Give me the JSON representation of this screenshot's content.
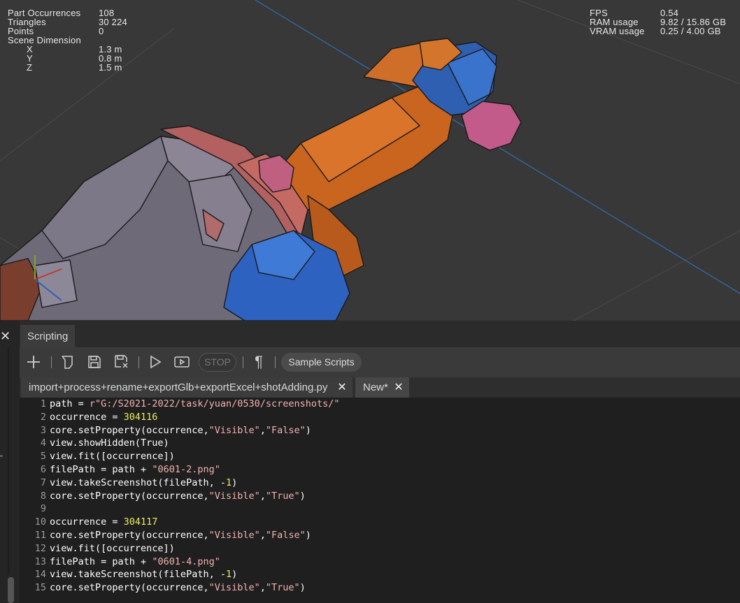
{
  "viewport": {
    "stats_left": [
      {
        "label": "Part Occurrences",
        "value": "108"
      },
      {
        "label": "Triangles",
        "value": "30 224"
      },
      {
        "label": "Points",
        "value": "0"
      },
      {
        "label": "Scene Dimension",
        "value": ""
      },
      {
        "label": "X",
        "value": "1.3 m"
      },
      {
        "label": "Y",
        "value": "0.8 m"
      },
      {
        "label": "Z",
        "value": "1.5 m"
      }
    ],
    "stats_right": [
      {
        "label": "FPS",
        "value": "0.54"
      },
      {
        "label": "RAM usage",
        "value": "9.82 / 15.86 GB"
      },
      {
        "label": "VRAM usage",
        "value": "0.25 / 4.00 GB"
      }
    ],
    "colors": {
      "background": "#383838",
      "axis_line": "#2f6fb5"
    }
  },
  "panel": {
    "close_glyph": "✕",
    "tab_label": "Scripting",
    "left_strip_mark": "\""
  },
  "toolbar": {
    "icons": [
      "add-icon",
      "open-file-icon",
      "save-icon",
      "save-as-icon",
      "play-icon",
      "run-screen-icon",
      "stop-button",
      "paragraph-icon",
      "sample-scripts-button"
    ],
    "stop_label": "STOP",
    "paragraph_glyph": "¶",
    "sample_scripts_label": "Sample Scripts"
  },
  "file_tabs": [
    {
      "label": "import+process+rename+exportGlb+exportExcel+shotAdding.py",
      "close": "✕"
    },
    {
      "label": "New*",
      "close": "✕"
    }
  ],
  "editor": {
    "lines": [
      {
        "n": "1",
        "tokens": [
          [
            "t",
            "path = "
          ],
          [
            "s",
            "r\"G:/S2021-2022/task/yuan/0530/screenshots/\""
          ]
        ]
      },
      {
        "n": "2",
        "tokens": [
          [
            "t",
            "occurrence = "
          ],
          [
            "n",
            "304116"
          ]
        ]
      },
      {
        "n": "3",
        "tokens": [
          [
            "t",
            "core.setProperty(occurrence,"
          ],
          [
            "s",
            "\"Visible\""
          ],
          [
            "t",
            ","
          ],
          [
            "s",
            "\"False\""
          ],
          [
            "t",
            ")"
          ]
        ]
      },
      {
        "n": "4",
        "tokens": [
          [
            "t",
            "view.showHidden(True)"
          ]
        ]
      },
      {
        "n": "5",
        "tokens": [
          [
            "t",
            "view.fit([occurrence])"
          ]
        ]
      },
      {
        "n": "6",
        "tokens": [
          [
            "t",
            "filePath = path + "
          ],
          [
            "s",
            "\"0601-2.png\""
          ]
        ]
      },
      {
        "n": "7",
        "tokens": [
          [
            "t",
            "view.takeScreenshot(filePath, -"
          ],
          [
            "n",
            "1"
          ],
          [
            "t",
            ")"
          ]
        ]
      },
      {
        "n": "8",
        "tokens": [
          [
            "t",
            "core.setProperty(occurrence,"
          ],
          [
            "s",
            "\"Visible\""
          ],
          [
            "t",
            ","
          ],
          [
            "s",
            "\"True\""
          ],
          [
            "t",
            ")"
          ]
        ]
      },
      {
        "n": "9",
        "tokens": []
      },
      {
        "n": "10",
        "tokens": [
          [
            "t",
            "occurrence = "
          ],
          [
            "n",
            "304117"
          ]
        ]
      },
      {
        "n": "11",
        "tokens": [
          [
            "t",
            "core.setProperty(occurrence,"
          ],
          [
            "s",
            "\"Visible\""
          ],
          [
            "t",
            ","
          ],
          [
            "s",
            "\"False\""
          ],
          [
            "t",
            ")"
          ]
        ]
      },
      {
        "n": "12",
        "tokens": [
          [
            "t",
            "view.fit([occurrence])"
          ]
        ]
      },
      {
        "n": "13",
        "tokens": [
          [
            "t",
            "filePath = path + "
          ],
          [
            "s",
            "\"0601-4.png\""
          ]
        ]
      },
      {
        "n": "14",
        "tokens": [
          [
            "t",
            "view.takeScreenshot(filePath, -"
          ],
          [
            "n",
            "1"
          ],
          [
            "t",
            ")"
          ]
        ]
      },
      {
        "n": "15",
        "tokens": [
          [
            "t",
            "core.setProperty(occurrence,"
          ],
          [
            "s",
            "\"Visible\""
          ],
          [
            "t",
            ","
          ],
          [
            "s",
            "\"True\""
          ],
          [
            "t",
            ")"
          ]
        ]
      }
    ],
    "colors": {
      "string": "#f3b2b0",
      "number": "#ecec5a",
      "text": "#ffffff",
      "line_number": "#9a9a9a",
      "background": "#1f1f1f"
    }
  }
}
